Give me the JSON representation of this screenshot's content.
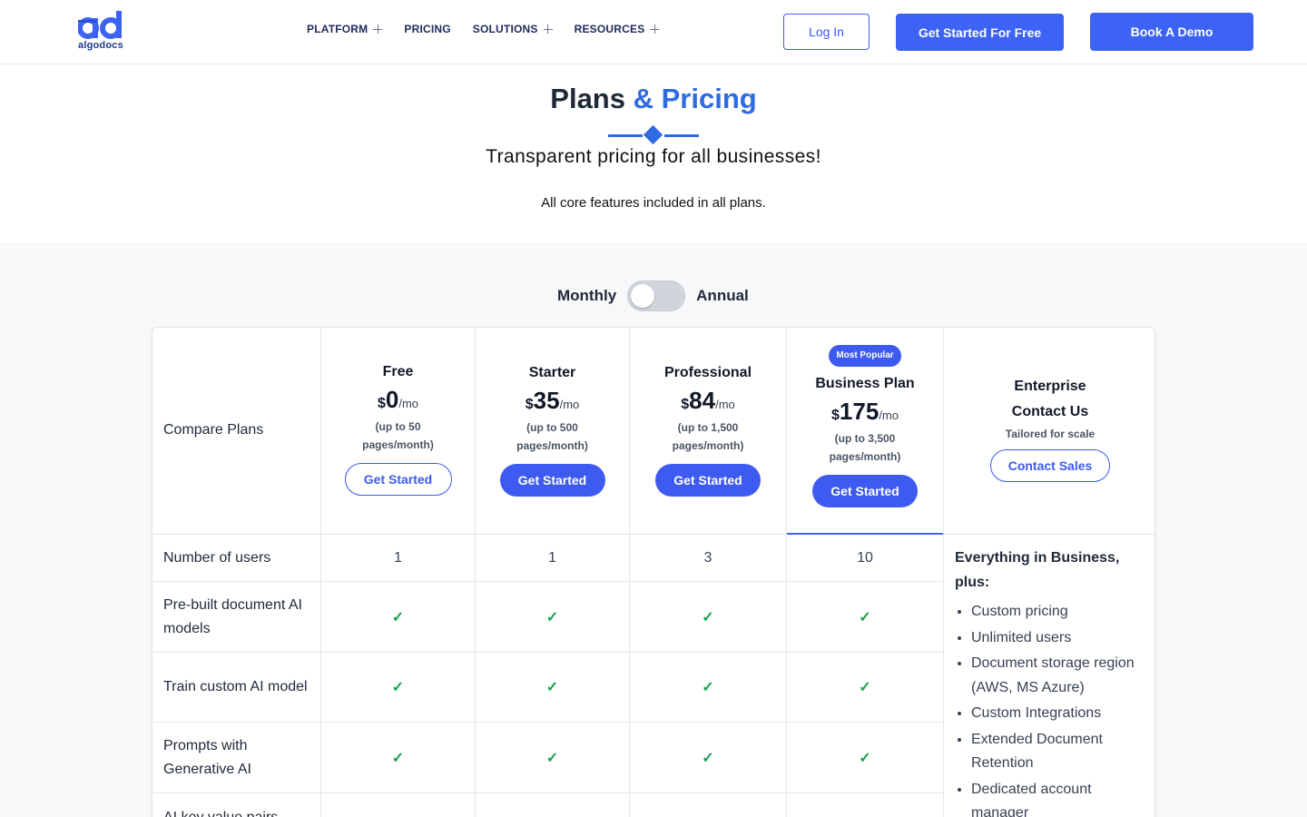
{
  "header": {
    "logo_mark": "ad",
    "logo_text": "algodocs",
    "nav": [
      {
        "label": "PLATFORM",
        "has_submenu": true
      },
      {
        "label": "PRICING",
        "has_submenu": false
      },
      {
        "label": "SOLUTIONS",
        "has_submenu": true
      },
      {
        "label": "RESOURCES",
        "has_submenu": true
      }
    ],
    "login_label": "Log In",
    "get_started_label": "Get Started For Free",
    "book_demo_label": "Book A Demo"
  },
  "hero": {
    "title_main": "Plans",
    "title_accent": "& Pricing",
    "subtitle": "Transparent pricing for all businesses!",
    "note": "All core features included in all plans."
  },
  "billing_toggle": {
    "left_label": "Monthly",
    "right_label": "Annual",
    "annual_selected": false
  },
  "table": {
    "compare_label": "Compare Plans",
    "plans": [
      {
        "name": "Free",
        "currency": "$",
        "price": "0",
        "period": "/mo",
        "pages_line1": "(up to 50",
        "pages_line2": "pages/month)",
        "button": "Get Started",
        "button_style": "outline"
      },
      {
        "name": "Starter",
        "currency": "$",
        "price": "35",
        "period": "/mo",
        "pages_line1": "(up to 500",
        "pages_line2": "pages/month)",
        "button": "Get Started",
        "button_style": "filled"
      },
      {
        "name": "Professional",
        "currency": "$",
        "price": "84",
        "period": "/mo",
        "pages_line1": "(up to 1,500",
        "pages_line2": "pages/month)",
        "button": "Get Started",
        "button_style": "filled"
      },
      {
        "name": "Business Plan",
        "badge": "Most Popular",
        "currency": "$",
        "price": "175",
        "period": "/mo",
        "pages_line1": "(up to 3,500",
        "pages_line2": "pages/month)",
        "button": "Get Started",
        "button_style": "filled"
      }
    ],
    "enterprise": {
      "name": "Enterprise",
      "subtitle": "Contact Us",
      "tagline": "Tailored for scale",
      "button": "Contact Sales",
      "lead": "Everything in Business, plus:",
      "features": [
        "Custom pricing",
        "Unlimited users",
        "Document storage region (AWS, MS Azure)",
        "Custom Integrations",
        "Extended Document Retention",
        "Dedicated account manager"
      ]
    },
    "rows": [
      {
        "label": "Number of users",
        "values": [
          "1",
          "1",
          "3",
          "10"
        ]
      },
      {
        "label": "Pre-built document AI models",
        "values": [
          "✓",
          "✓",
          "✓",
          "✓"
        ]
      },
      {
        "label": "Train custom AI model",
        "values": [
          "✓",
          "✓",
          "✓",
          "✓"
        ]
      },
      {
        "label": "Prompts with Generative AI",
        "values": [
          "✓",
          "✓",
          "✓",
          "✓"
        ]
      },
      {
        "label": "AI key value pairs",
        "values": [
          "",
          "",
          "",
          ""
        ]
      }
    ]
  },
  "colors": {
    "brand_blue": "#3d5af1",
    "accent_blue": "#2f6be0",
    "check_green": "#16a34a"
  }
}
